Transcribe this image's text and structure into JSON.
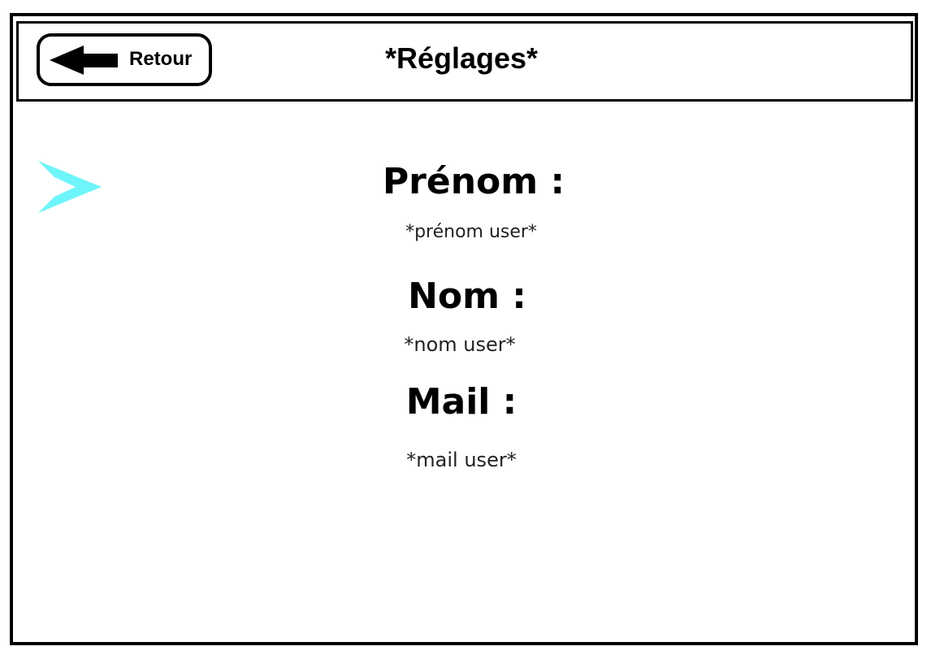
{
  "header": {
    "title": "*Réglages*",
    "back_button": {
      "label": "Retour",
      "icon": "arrow-left-icon"
    }
  },
  "pointer": {
    "icon": "chevron-pointer-icon",
    "color": "#66f3f8"
  },
  "fields": {
    "prenom": {
      "label": "Prénom :",
      "value": "*prénom user*"
    },
    "nom": {
      "label": "Nom :",
      "value": "*nom user*"
    },
    "mail": {
      "label": "Mail :",
      "value": "*mail user*"
    }
  }
}
